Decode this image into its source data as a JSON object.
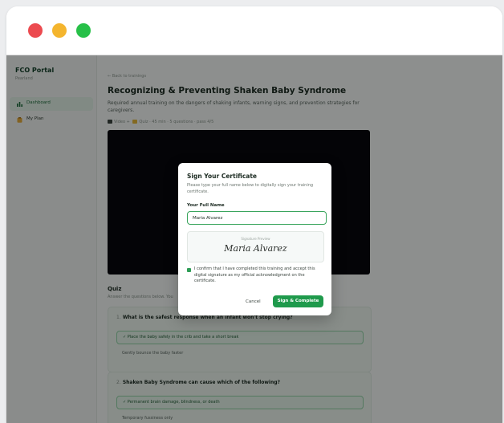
{
  "sidebar": {
    "brand_title": "FCO Portal",
    "brand_sub": "Pearland",
    "items": [
      {
        "label": "Dashboard",
        "icon": "chart-icon",
        "active": true
      },
      {
        "label": "My Plan",
        "icon": "clipboard-icon",
        "active": false
      }
    ]
  },
  "main": {
    "back_link": "← Back to trainings",
    "title": "Recognizing & Preventing Shaken Baby Syndrome",
    "description": "Required annual training on the dangers of shaking infants, warning signs, and prevention strategies for caregivers.",
    "meta_video": "Video + ",
    "meta_rest": "Quiz · 45 min · 5 questions · pass 4/5",
    "quiz_title": "Quiz",
    "quiz_sub": "Answer the questions below. You",
    "questions": [
      {
        "num": "1.",
        "text": "What is the safest response when an infant won't stop crying?",
        "options": [
          {
            "text": "✓  Place the baby safely in the crib and take a short break",
            "correct": true
          },
          {
            "text": "Gently bounce the baby faster",
            "correct": false
          }
        ]
      },
      {
        "num": "2.",
        "text": "Shaken Baby Syndrome can cause which of the following?",
        "options": [
          {
            "text": "✓  Permanent brain damage, blindness, or death",
            "correct": true
          },
          {
            "text": "Temporary fussiness only",
            "correct": false
          }
        ]
      }
    ]
  },
  "modal": {
    "title": "Sign Your Certificate",
    "subtitle": "Please type your full name below to digitally sign your training certificate.",
    "name_label": "Your Full Name",
    "name_value": "Maria Alvarez",
    "preview_caption": "Signature Preview",
    "signature": "Maria Alvarez",
    "confirm_text": "I confirm that I have completed this training and accept this digital signature as my official acknowledgment on the certificate.",
    "confirm_checked": true,
    "cancel_label": "Cancel",
    "submit_label": "Sign & Complete"
  },
  "colors": {
    "accent": "#1f9a4c",
    "traffic_red": "#ec4a4f",
    "traffic_yellow": "#f4b52e",
    "traffic_green": "#27c048"
  }
}
